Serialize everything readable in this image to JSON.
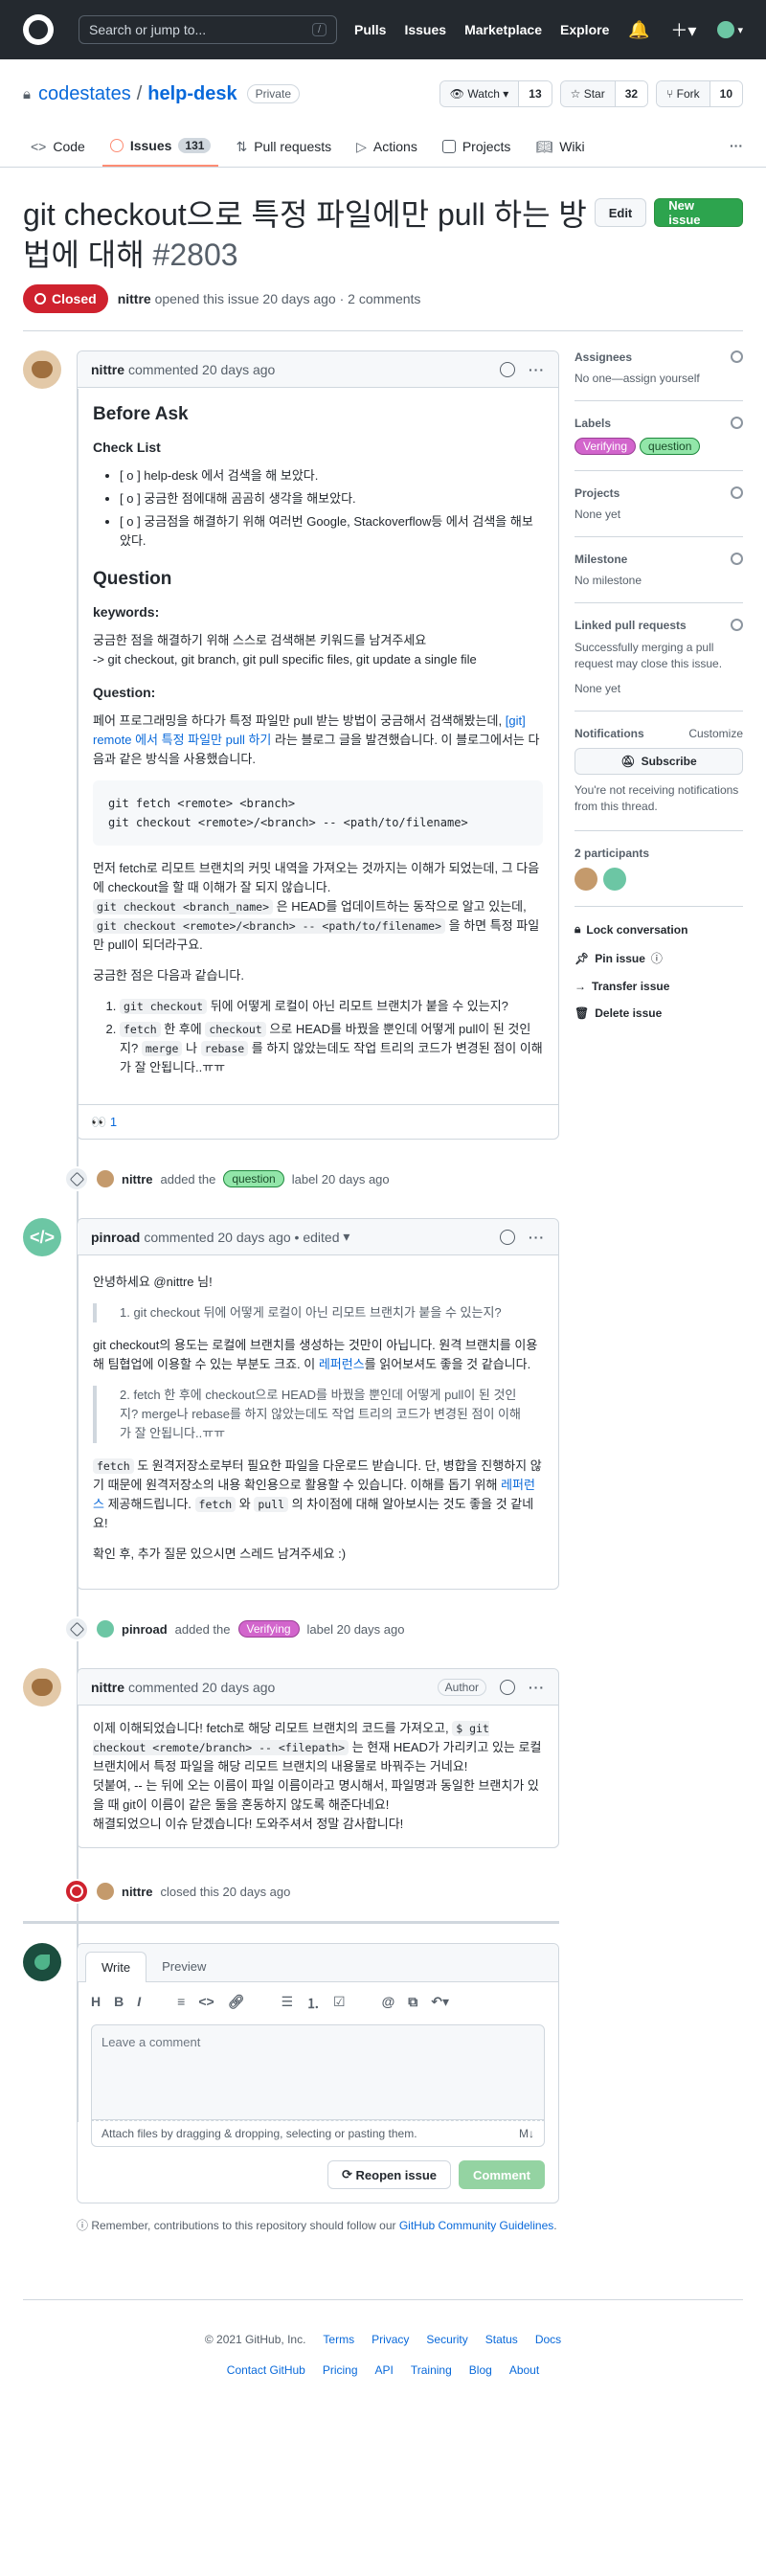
{
  "header": {
    "search_placeholder": "Search or jump to...",
    "search_shortcut": "/",
    "nav": [
      "Pulls",
      "Issues",
      "Marketplace",
      "Explore"
    ]
  },
  "repo": {
    "owner": "codestates",
    "name": "help-desk",
    "visibility": "Private",
    "watch_label": "Watch",
    "watch_count": "13",
    "star_label": "Star",
    "star_count": "32",
    "fork_label": "Fork",
    "fork_count": "10",
    "tabs": [
      {
        "label": "Code",
        "count": ""
      },
      {
        "label": "Issues",
        "count": "131"
      },
      {
        "label": "Pull requests",
        "count": ""
      },
      {
        "label": "Actions",
        "count": ""
      },
      {
        "label": "Projects",
        "count": ""
      },
      {
        "label": "Wiki",
        "count": ""
      }
    ]
  },
  "issue": {
    "title": "git checkout으로 특정 파일에만 pull 하는 방법에 대해",
    "number": "#2803",
    "edit_label": "Edit",
    "new_label": "New issue",
    "state": "Closed",
    "author": "nittre",
    "meta": "opened this issue 20 days ago · 2 comments"
  },
  "comments": [
    {
      "author": "nittre",
      "meta": "commented 20 days ago",
      "h_before": "Before Ask",
      "h_checklist": "Check List",
      "checklist": [
        "[ o ] help-desk 에서 검색을 해 보았다.",
        "[ o ] 궁금한 점에대해 곰곰히 생각을 해보았다.",
        "[ o ] 궁금점을 해결하기 위해 여러번 Google, Stackoverflow등 에서 검색을 해보았다."
      ],
      "h_question": "Question",
      "h_keywords": "keywords:",
      "kw_line1": "궁금한 점을 해결하기 위해 스스로 검색해본 키워드를 남겨주세요",
      "kw_line2": "-> git checkout, git branch, git pull specific files, git update a single file",
      "h_question2": "Question:",
      "q_p1_a": "페어 프로그래밍을 하다가 특정 파일만 pull 받는 방법이 궁금해서 검색해봤는데, ",
      "q_p1_link": "[git] remote 에서 특정 파일만 pull 하기",
      "q_p1_b": " 라는 블로그 글을 발견했습니다. 이 블로그에서는 다음과 같은 방식을 사용했습니다.",
      "code": "git fetch <remote> <branch>\ngit checkout <remote>/<branch> -- <path/to/filename>",
      "q_p2_a": "먼저 fetch로 리모트 브랜치의 커밋 내역을 가져오는 것까지는 이해가 되었는데, 그 다음에 checkout을 할 때 이해가 잘 되지 않습니다.",
      "q_p2_code1": "git checkout <branch_name>",
      "q_p2_b": " 은 HEAD를 업데이트하는 동작으로 알고 있는데, ",
      "q_p2_code2": "git checkout <remote>/<branch> -- <path/to/filename>",
      "q_p2_c": " 을 하면 특정 파일만 pull이 되더라구요.",
      "q_p3": "궁금한 점은 다음과 같습니다.",
      "q_li1_code": "git checkout",
      "q_li1_text": " 뒤에 어떻게 로컬이 아닌 리모트 브랜치가 붙을 수 있는지?",
      "q_li2_code1": "fetch",
      "q_li2_t1": " 한 후에 ",
      "q_li2_code2": "checkout",
      "q_li2_t2": " 으로 HEAD를 바꿨을 뿐인데 어떻게 pull이 된 것인지? ",
      "q_li2_code3": "merge",
      "q_li2_t3": " 나 ",
      "q_li2_code4": "rebase",
      "q_li2_t4": " 를 하지 않았는데도 작업 트리의 코드가 변경된 점이 이해가 잘 안됩니다..ㅠㅠ",
      "reaction_emoji": "👀",
      "reaction_count": "1"
    },
    {
      "author": "pinroad",
      "meta": "commented 20 days ago • edited",
      "greeting": "안녕하세요 @nittre 님!",
      "quote1": "1. git checkout 뒤에 어떻게 로컬이 아닌 리모트 브랜치가 붙을 수 있는지?",
      "p1_a": "git checkout의 용도는 로컬에 브랜치를 생성하는 것만이 아닙니다. 원격 브랜치를 이용해 팀협업에 이용할 수 있는 부분도 크죠. 이 ",
      "p1_link": "레퍼런스",
      "p1_b": "를 읽어보셔도 좋을 것 같습니다.",
      "quote2": "2. fetch 한 후에 checkout으로 HEAD를 바꿨을 뿐인데 어떻게 pull이 된 것인지? merge나 rebase를 하지 않았는데도 작업 트리의 코드가 변경된 점이 이해가 잘 안됩니다..ㅠㅠ",
      "p2_code1": "fetch",
      "p2_a": " 도 원격저장소로부터 필요한 파일을 다운로드 받습니다. 단, 병합을 진행하지 않기 때문에 원격저장소의 내용 확인용으로 활용할 수 있습니다. 이해를 돕기 위해 ",
      "p2_link": "레퍼런스",
      "p2_b": " 제공해드립니다. ",
      "p2_code2": "fetch",
      "p2_c": " 와 ",
      "p2_code3": "pull",
      "p2_d": " 의 차이점에 대해 알아보시는 것도 좋을 것 같네요!",
      "p3": "확인 후, 추가 질문 있으시면 스레드 남겨주세요 :)"
    },
    {
      "author": "nittre",
      "meta": "commented 20 days ago",
      "badge": "Author",
      "l1_a": "이제 이해되었습니다! fetch로 해당 리모트 브랜치의 코드를 가져오고, ",
      "l1_code": "$ git checkout <remote/branch> -- <filepath>",
      "l1_b": " 는 현재 HEAD가 가리키고 있는 로컬 브랜치에서 특정 파일을 해당 리모트 브랜치의 내용물로 바꿔주는 거네요!",
      "l2": "덧붙여, -- 는 뒤에 오는 이름이 파일 이름이라고 명시해서, 파일명과 동일한 브랜치가 있을 때 git이 이름이 같은 둘을 혼동하지 않도록 해준다네요!",
      "l3": "해결되었으니 이슈 닫겠습니다! 도와주셔서 정말 감사합니다!"
    }
  ],
  "events": [
    {
      "actor": "nittre",
      "pre": "added the",
      "label": "question",
      "post": "label 20 days ago"
    },
    {
      "actor": "pinroad",
      "pre": "added the",
      "label": "Verifying",
      "post": "label 20 days ago"
    },
    {
      "actor": "nittre",
      "text": "closed this 20 days ago"
    }
  ],
  "sidebar": {
    "assignees_title": "Assignees",
    "assignees_value": "No one—assign yourself",
    "labels_title": "Labels",
    "labels": [
      "Verifying",
      "question"
    ],
    "projects_title": "Projects",
    "projects_value": "None yet",
    "milestone_title": "Milestone",
    "milestone_value": "No milestone",
    "linked_title": "Linked pull requests",
    "linked_desc": "Successfully merging a pull request may close this issue.",
    "linked_value": "None yet",
    "notif_title": "Notifications",
    "notif_customize": "Customize",
    "subscribe_label": "Subscribe",
    "notif_desc": "You're not receiving notifications from this thread.",
    "participants_title": "2 participants",
    "actions": [
      "Lock conversation",
      "Pin issue",
      "Transfer issue",
      "Delete issue"
    ]
  },
  "editor": {
    "tab_write": "Write",
    "tab_preview": "Preview",
    "placeholder": "Leave a comment",
    "attach_text": "Attach files by dragging & dropping, selecting or pasting them.",
    "reopen_label": "Reopen issue",
    "comment_label": "Comment",
    "note_a": "Remember, contributions to this repository should follow our ",
    "note_link": "GitHub Community Guidelines",
    "note_b": "."
  },
  "footer": {
    "copyright": "© 2021 GitHub, Inc.",
    "row1": [
      "Terms",
      "Privacy",
      "Security",
      "Status",
      "Docs"
    ],
    "row2": [
      "Contact GitHub",
      "Pricing",
      "API",
      "Training",
      "Blog",
      "About"
    ]
  }
}
